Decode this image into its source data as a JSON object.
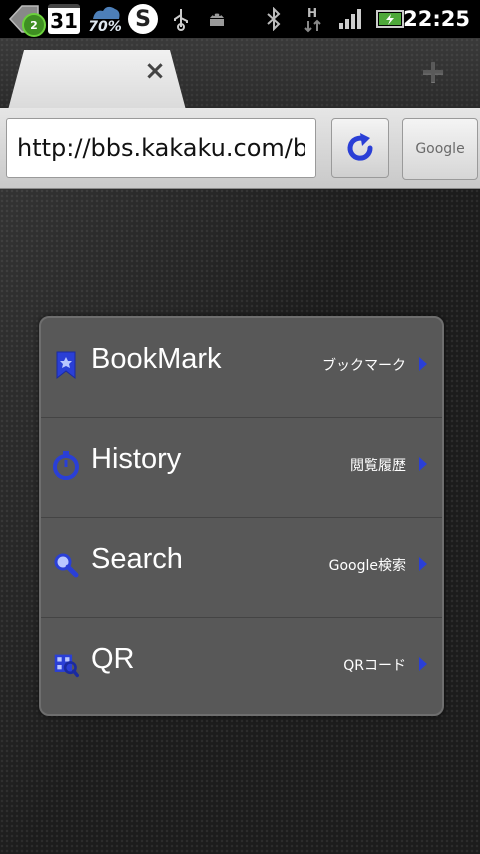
{
  "status_bar": {
    "notification_count": "2",
    "calendar_day": "31",
    "percent": "70%",
    "skype_letter": "S",
    "time": "22:25",
    "icons": [
      "back-app-icon",
      "calendar-icon",
      "weather-icon",
      "skype-icon",
      "usb-icon",
      "android-icon",
      "bluetooth-icon",
      "hspa-data-icon",
      "signal-icon",
      "battery-charging-icon"
    ]
  },
  "tabs": {
    "active_tab_title": "",
    "close_label": "×",
    "add_label": "+"
  },
  "url_bar": {
    "url": "http://bbs.kakaku.com/bbs/",
    "search_engine_label": "Google"
  },
  "menu": {
    "items": [
      {
        "label": "BookMark",
        "sub": "ブックマーク",
        "icon": "bookmark-icon"
      },
      {
        "label": "History",
        "sub": "閲覧履歴",
        "icon": "stopwatch-icon"
      },
      {
        "label": "Search",
        "sub": "Google検索",
        "icon": "magnifier-icon"
      },
      {
        "label": "QR",
        "sub": "QRコード",
        "icon": "qr-scan-icon"
      }
    ]
  },
  "colors": {
    "accent_blue": "#2a3fd6",
    "panel_bg": "#585858",
    "status_bar_bg": "#000000"
  }
}
